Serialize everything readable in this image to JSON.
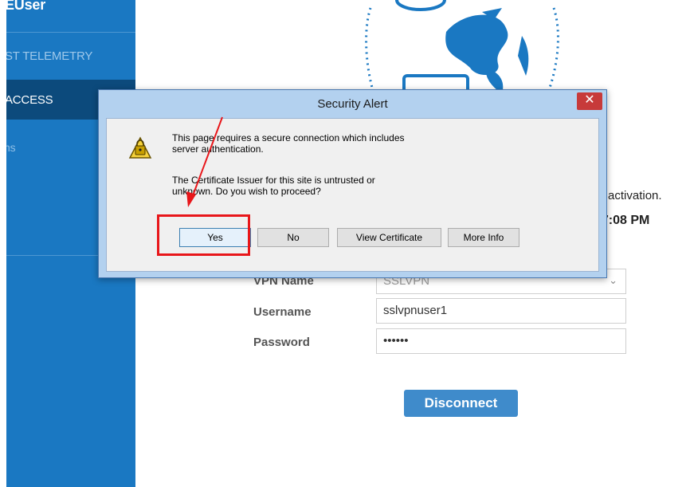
{
  "sidebar": {
    "items": [
      {
        "label": "EUser"
      },
      {
        "label": "ST TELEMETRY"
      },
      {
        "label": "ACCESS"
      },
      {
        "label": "ns"
      }
    ]
  },
  "main": {
    "activation_text": "se activation.",
    "time_text": "47:08 PM",
    "form": {
      "vpn_label": "VPN Name",
      "vpn_value": "SSLVPN",
      "username_label": "Username",
      "username_value": "sslvpnuser1",
      "password_label": "Password",
      "password_value": "••••••"
    },
    "disconnect_label": "Disconnect"
  },
  "dialog": {
    "title": "Security Alert",
    "close": "✕",
    "message1_line1": "This page requires a secure connection which includes",
    "message1_line2": "server authentication.",
    "message2_line1": "The Certificate Issuer for this site is untrusted or",
    "message2_line2": "unknown.  Do you wish to proceed?",
    "buttons": {
      "yes": "Yes",
      "no": "No",
      "view_certificate": "View Certificate",
      "more_info": "More Info"
    }
  },
  "colors": {
    "sidebar": "#1a78c2",
    "sidebar_active": "#0c4a7c",
    "annotation": "#e8161a",
    "accent": "#3f8bcb"
  }
}
